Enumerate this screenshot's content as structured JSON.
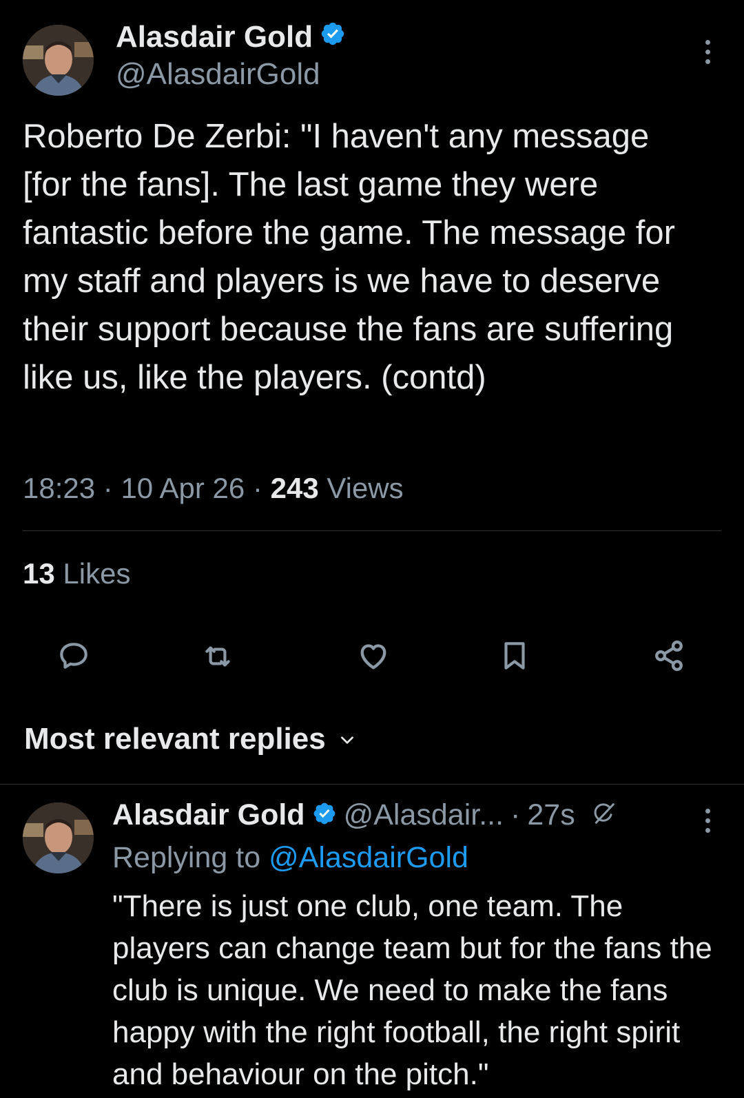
{
  "tweet": {
    "author_name": "Alasdair Gold",
    "author_handle": "@AlasdairGold",
    "text": "Roberto De Zerbi: \"I haven't any message [for the fans]. The last game they were fantastic before the game. The message for my staff and players is we have to deserve their support because the fans are suffering like us, like the players. (contd)",
    "time": "18:23",
    "date": "10 Apr 26",
    "views_count": "243",
    "views_label": "Views",
    "separator": "·",
    "likes_count": "13",
    "likes_label": "Likes"
  },
  "actions": {
    "reply_icon": "reply-icon",
    "retweet_icon": "retweet-icon",
    "like_icon": "heart-icon",
    "bookmark_icon": "bookmark-icon",
    "share_icon": "share-icon"
  },
  "replies_section": {
    "title": "Most relevant replies"
  },
  "reply": {
    "author_name": "Alasdair Gold",
    "author_handle": "@Alasdair...",
    "separator": "·",
    "time": "27s",
    "replying_prefix": "Replying to",
    "replying_mention": "@AlasdairGold",
    "text": "\"There is just one club, one team. The players can change team but for the fans the club is unique. We need to make the fans happy with the right football, the right spirit and behaviour on the pitch.\""
  },
  "colors": {
    "background": "#000000",
    "text_primary": "#e7e9ea",
    "text_secondary": "#8b98a5",
    "accent": "#1d9bf0",
    "divider": "#2f3336"
  }
}
